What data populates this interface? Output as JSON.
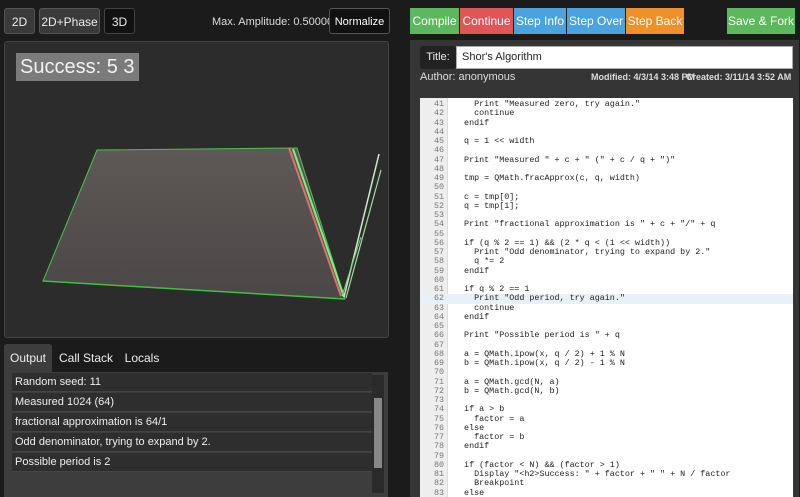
{
  "view_buttons": [
    "2D",
    "2D+Phase",
    "3D"
  ],
  "amplitude_text": "Max. Amplitude: 0.500000",
  "normalize_label": "Normalize",
  "viewport": {
    "success_text": "Success: 5 3"
  },
  "output_tabs": [
    "Output",
    "Call Stack",
    "Locals"
  ],
  "output_lines": [
    "Random seed: 11",
    "Measured 1024 (64)",
    "fractional approximation is 64/1",
    "Odd denominator, trying to expand by 2.",
    "Possible period is 2"
  ],
  "toolbar": {
    "compile": "Compile",
    "continue": "Continue",
    "step_info": "Step Info",
    "step_over": "Step Over",
    "step_back": "Step Back",
    "save_fork": "Save & Fork"
  },
  "editor": {
    "title_label": "Title:",
    "title_value": "Shor's Algorithm",
    "author": "Author: anonymous",
    "modified": "Modified: 4/3/14 3:48 PM",
    "created": "Created: 3/11/14 3:52 AM"
  },
  "code_lines": [
    [
      "41",
      "    Print \"Measured zero, try again.\""
    ],
    [
      "42",
      "    continue"
    ],
    [
      "43",
      "  endif"
    ],
    [
      "44",
      ""
    ],
    [
      "45",
      "  q = 1 << width"
    ],
    [
      "46",
      ""
    ],
    [
      "47",
      "  Print \"Measured \" + c + \" (\" + c / q + \")\""
    ],
    [
      "48",
      ""
    ],
    [
      "49",
      "  tmp = QMath.fracApprox(c, q, width)"
    ],
    [
      "50",
      ""
    ],
    [
      "51",
      "  c = tmp[0];"
    ],
    [
      "52",
      "  q = tmp[1];"
    ],
    [
      "53",
      ""
    ],
    [
      "54",
      "  Print \"fractional approximation is \" + c + \"/\" + q"
    ],
    [
      "55",
      ""
    ],
    [
      "56",
      "  if (q % 2 == 1) && (2 * q < (1 << width))"
    ],
    [
      "57",
      "    Print \"Odd denominator, trying to expand by 2.\""
    ],
    [
      "58",
      "    q *= 2"
    ],
    [
      "59",
      "  endif"
    ],
    [
      "60",
      ""
    ],
    [
      "61",
      "  if q % 2 == 1"
    ],
    [
      "62",
      "    Print \"Odd period, try again.\""
    ],
    [
      "63",
      "    continue"
    ],
    [
      "64",
      "  endif"
    ],
    [
      "65",
      ""
    ],
    [
      "66",
      "  Print \"Possible period is \" + q"
    ],
    [
      "67",
      ""
    ],
    [
      "68",
      "  a = QMath.ipow(x, q / 2) + 1 % N"
    ],
    [
      "69",
      "  b = QMath.ipow(x, q / 2) - 1 % N"
    ],
    [
      "70",
      ""
    ],
    [
      "71",
      "  a = QMath.gcd(N, a)"
    ],
    [
      "72",
      "  b = QMath.gcd(N, b)"
    ],
    [
      "73",
      ""
    ],
    [
      "74",
      "  if a > b"
    ],
    [
      "75",
      "    factor = a"
    ],
    [
      "76",
      "  else"
    ],
    [
      "77",
      "    factor = b"
    ],
    [
      "78",
      "  endif"
    ],
    [
      "79",
      ""
    ],
    [
      "80",
      "  if (factor < N) && (factor > 1)"
    ],
    [
      "81",
      "    Display \"<h2>Success: \" + factor + \" \" + N / factor"
    ],
    [
      "82",
      "    Breakpoint"
    ],
    [
      "83",
      "  else"
    ]
  ],
  "highlighted_line": "62",
  "colors": {
    "compile": "#5cb85c",
    "continue": "#e05656",
    "step_info": "#4aa3df",
    "step_over": "#4aa3df",
    "step_back": "#f0902b",
    "save_fork": "#5cb85c",
    "plane": "#5a5350",
    "plane_edge": "#5fce5f"
  }
}
